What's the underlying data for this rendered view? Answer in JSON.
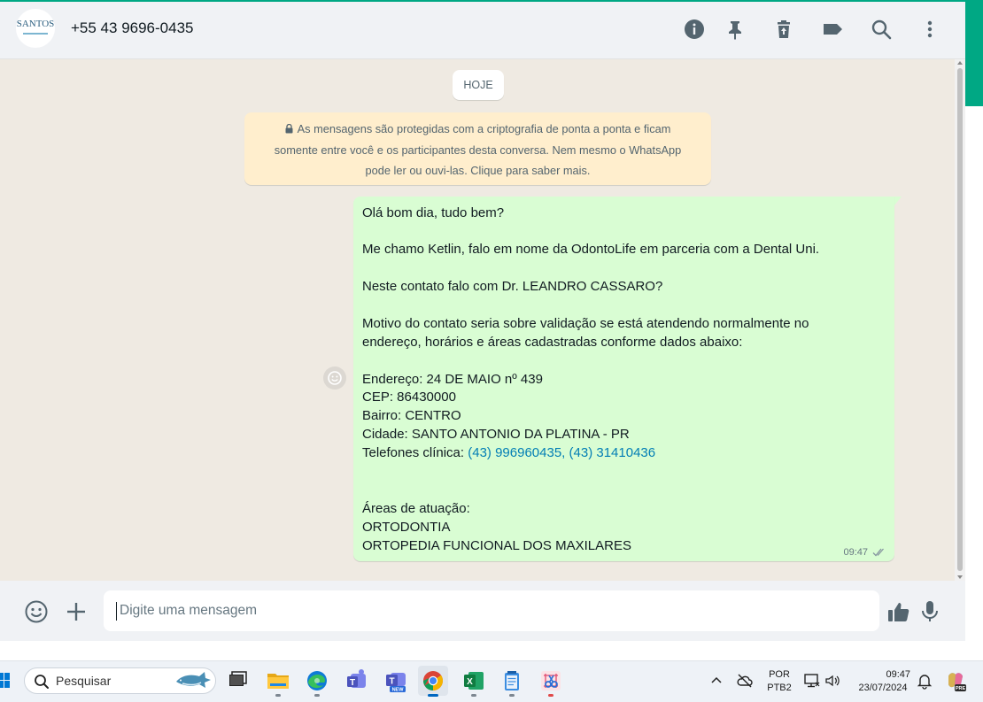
{
  "header": {
    "avatar_logo_text": "SANTOS",
    "contact_name": "+55 43 9696-0435",
    "icons": [
      "info-icon",
      "pin-icon",
      "delete-icon",
      "label-icon",
      "search-icon",
      "menu-icon"
    ]
  },
  "chat": {
    "date_divider": "HOJE",
    "encryption_notice": {
      "line1": "As mensagens são protegidas com a criptografia de ponta a ponta e ficam",
      "line2": "somente entre você e os participantes desta conversa. Nem mesmo o WhatsApp",
      "line3": "pode ler ou ouvi-las. Clique para saber mais."
    },
    "message": {
      "greeting": "Olá bom dia, tudo bem?",
      "intro": "Me chamo Ketlin, falo em nome da OdontoLife em parceria com a Dental Uni.",
      "question": "Neste contato falo com Dr. LEANDRO CASSARO?",
      "reason_line1": "Motivo do contato seria sobre validação se está atendendo normalmente no",
      "reason_line2": "endereço, horários e áreas cadastradas conforme dados abaixo:",
      "address": "Endereço: 24 DE MAIO nº 439",
      "cep": "CEP: 86430000",
      "neighborhood": "Bairro: CENTRO",
      "city": "Cidade: SANTO ANTONIO DA PLATINA - PR",
      "phones_label": "Telefones clínica: ",
      "phone1": "(43) 996960435",
      "phone_sep": ", ",
      "phone2": "(43) 31410436",
      "areas_label": "Áreas de atuação:",
      "area1": "ORTODONTIA",
      "area2": "ORTOPEDIA FUNCIONAL DOS MAXILARES",
      "time": "09:47",
      "status": "delivered"
    }
  },
  "composer": {
    "placeholder": "Digite uma mensagem"
  },
  "taskbar": {
    "search_label": "Pesquisar",
    "language_line1": "POR",
    "language_line2": "PTB2",
    "time": "09:47",
    "date": "23/07/2024",
    "apps": [
      "file-explorer-icon",
      "edge-icon",
      "teams-icon",
      "teams-new-icon",
      "chrome-icon",
      "excel-icon",
      "notepad-icon",
      "snipping-tool-icon"
    ]
  },
  "colors": {
    "accent": "#00a884",
    "bubble_out": "#d9fdd3",
    "notice_bg": "#ffeecd",
    "chat_bg": "#efeae2",
    "link": "#027eb5"
  }
}
